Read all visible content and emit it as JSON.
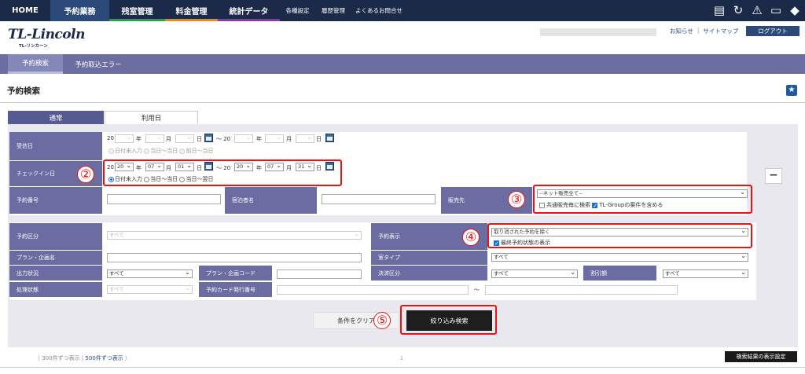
{
  "topnav": {
    "items": [
      {
        "label": "HOME",
        "bar": ""
      },
      {
        "label": "予約業務",
        "bar": "#2b4a7a"
      },
      {
        "label": "残室管理",
        "bar": "#2aa048"
      },
      {
        "label": "料金管理",
        "bar": "#e38a1a"
      },
      {
        "label": "統計データ",
        "bar": "#8a3aa8"
      },
      {
        "label": "各種設定",
        "bar": ""
      },
      {
        "label": "履歴管理",
        "bar": ""
      },
      {
        "label": "よくあるお問合せ",
        "bar": ""
      }
    ],
    "icons": [
      "clipboard-icon",
      "refresh-icon",
      "warning-icon",
      "monitor-icon",
      "user-icon"
    ]
  },
  "header": {
    "logo": "TL-Lincoln",
    "logo_sub": "TL-リンカーン",
    "links": [
      "お知らせ",
      "|",
      "サイトマップ"
    ],
    "logout": "ログアウト"
  },
  "subnav": {
    "tabs": [
      "予約検索",
      "予約取込エラー"
    ]
  },
  "page_title": "予約検索",
  "search_tabs": [
    "通常",
    "利用日"
  ],
  "form": {
    "receipt": {
      "label": "受信日",
      "year_prefix": "20",
      "year": "年",
      "month": "月",
      "day": "日",
      "tilde": "〜 20",
      "radios": [
        "日付未入力",
        "当日〜当日",
        "前日〜当日"
      ]
    },
    "checkin": {
      "label": "チェックイン日",
      "from_year": "20",
      "from_month": "07",
      "from_day": "01",
      "to_year": "20",
      "to_month": "07",
      "to_day": "31",
      "radios": [
        "日付未入力",
        "当日〜当日",
        "当日〜翌日"
      ]
    },
    "reservation_no": "予約番号",
    "guest_name": "宿泊者名",
    "sales_channel": {
      "label": "販売先",
      "value": "--ネット販売全て--",
      "check1": "共通販売毎に検索",
      "check2": "TL-Groupの案件を含める"
    },
    "reservation_type": {
      "label": "予約区分",
      "value": "すべて"
    },
    "reservation_display": {
      "label": "予約表示",
      "value": "取り消された予約を除く",
      "check": "最終予約状態の表示"
    },
    "plan_name": "プラン・企画名",
    "room_type": {
      "label": "室タイプ",
      "value": "すべて"
    },
    "output_status": {
      "label": "出力状況",
      "value": "すべて"
    },
    "plan_code": "プラン・企画コード",
    "payment_type": {
      "label": "決済区分",
      "value": "すべて"
    },
    "discount": {
      "label": "割引額",
      "value": "すべて"
    },
    "process_status": {
      "label": "処理状態",
      "value": "すべて"
    },
    "card_no": {
      "label": "予約カード発行番号",
      "tilde": "〜"
    }
  },
  "annotations": [
    "②",
    "③",
    "④",
    "⑤"
  ],
  "buttons": {
    "clear": "条件をクリア",
    "search": "絞り込み検索"
  },
  "footer": {
    "per_page_open": "（ 300件ずつ表示 |",
    "per_page_link": "500件ずつ表示",
    "per_page_close": "）",
    "page": "1",
    "display_settings": "検索結果の表示設定"
  }
}
